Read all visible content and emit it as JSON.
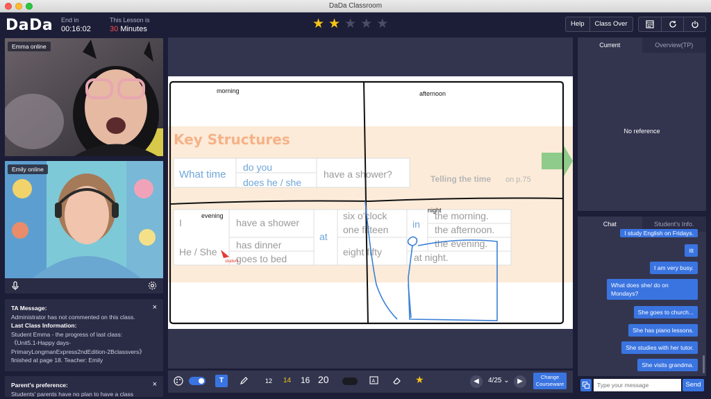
{
  "window": {
    "title": "DaDa Classroom"
  },
  "header": {
    "logo": "DaDa",
    "end_in_label": "End in",
    "end_in_value": "00:16:02",
    "lesson_label": "This Lesson is",
    "lesson_minutes": "30",
    "lesson_unit": "Minutes",
    "stars_total": 5,
    "stars_filled": 2,
    "help_label": "Help",
    "class_over_label": "Class Over",
    "icons": [
      "calculator-icon",
      "refresh-icon",
      "power-icon"
    ]
  },
  "videos": {
    "student_label": "Emma online",
    "teacher_label": "Emily online"
  },
  "ta_panel": {
    "title": "TA Message:",
    "message": "Administrator has not commented on this class.",
    "last_class_title": "Last Class Information:",
    "last_class_line1": "Student Emma - the progress of last class:",
    "last_class_line2": "《Unit5.1-Happy days-",
    "last_class_line3": "PrimaryLongmanExpress2ndEdition-2Bclassvers》",
    "last_class_line4": "finished at page 18. Teacher: Emily"
  },
  "parent_panel": {
    "title": "Parent's preference:",
    "text": "Students' parents have no plan to have a class"
  },
  "slide": {
    "title": "Key Structures",
    "telling_time": "Telling the time",
    "page_ref": "on p.75",
    "row1": [
      "What time",
      "do you",
      "does he / she",
      "have a shower?"
    ],
    "table": {
      "subjects": [
        "I",
        "He / She"
      ],
      "verbs_i": "have a shower",
      "verbs_he1": "has dinner",
      "verbs_he2": "goes to bed",
      "at": "at",
      "times": [
        "six o'clock",
        "one fifteen",
        "eight fifty"
      ],
      "in": "in",
      "periods": [
        "the morning.",
        "the afternoon.",
        "the evening.",
        "at night."
      ]
    },
    "drawn_labels": {
      "morning": "morning",
      "afternoon": "afternoon",
      "evening": "evening",
      "night": "night"
    },
    "cursor_label": "student"
  },
  "toolbar": {
    "font_sizes": [
      "12",
      "14",
      "16",
      "20"
    ],
    "active_size": "14",
    "page": "4/25",
    "change_courseware": [
      "Change",
      "Courseware"
    ]
  },
  "right_top": {
    "tabs": [
      "Current",
      "Overview(TP)"
    ],
    "empty_text": "No reference"
  },
  "chat": {
    "tabs": [
      "Chat",
      "Student's Info."
    ],
    "partial_message": "I study English on Fridays.",
    "messages": [
      "itt",
      "I am very busy.",
      "What does she/ do on Mondays?",
      "She goes to church...",
      "She has piano lessons.",
      "She studies with her tutor.",
      "She visits grandma."
    ],
    "input_placeholder": "Type your message",
    "send_label": "Send"
  },
  "colors": {
    "accent": "#3a74e0",
    "star": "#f5c518",
    "background": "#1c1d36",
    "pen_stroke": "#3a7fd6"
  }
}
